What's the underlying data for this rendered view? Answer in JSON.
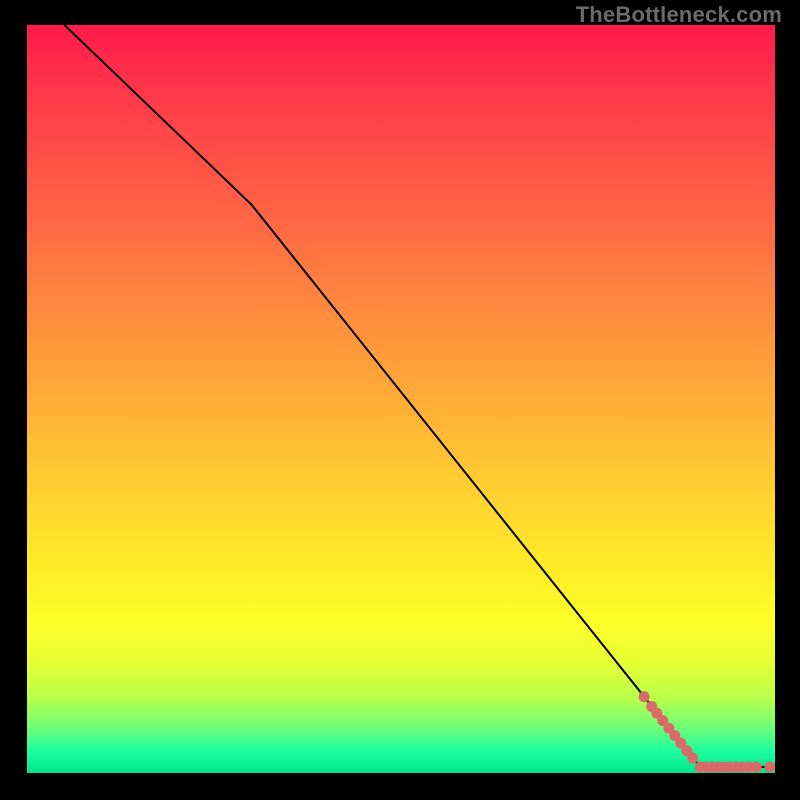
{
  "watermark": "TheBottleneck.com",
  "colors": {
    "marker": "#d86a6a",
    "curve": "#000000"
  },
  "chart_data": {
    "type": "line",
    "title": "",
    "xlabel": "",
    "ylabel": "",
    "xlim": [
      0,
      100
    ],
    "ylim": [
      0,
      100
    ],
    "grid": false,
    "legend": false,
    "annotations": [],
    "series": [
      {
        "name": "curve",
        "x": [
          5,
          30,
          90,
          100
        ],
        "y": [
          100,
          76,
          0.8,
          0.8
        ],
        "render": "line"
      },
      {
        "name": "markers",
        "x": [
          82.5,
          83.5,
          84.2,
          85.0,
          85.8,
          86.6,
          87.4,
          88.2,
          89.0,
          90.0,
          90.8,
          91.6,
          92.4,
          93.2,
          94.0,
          94.8,
          95.6,
          96.5,
          97.5,
          99.3
        ],
        "y": [
          10.2,
          8.9,
          8.0,
          7.0,
          6.0,
          5.0,
          4.0,
          3.0,
          2.0,
          0.8,
          0.8,
          0.8,
          0.8,
          0.8,
          0.8,
          0.8,
          0.8,
          0.8,
          0.8,
          0.8
        ],
        "render": "scatter"
      }
    ]
  }
}
